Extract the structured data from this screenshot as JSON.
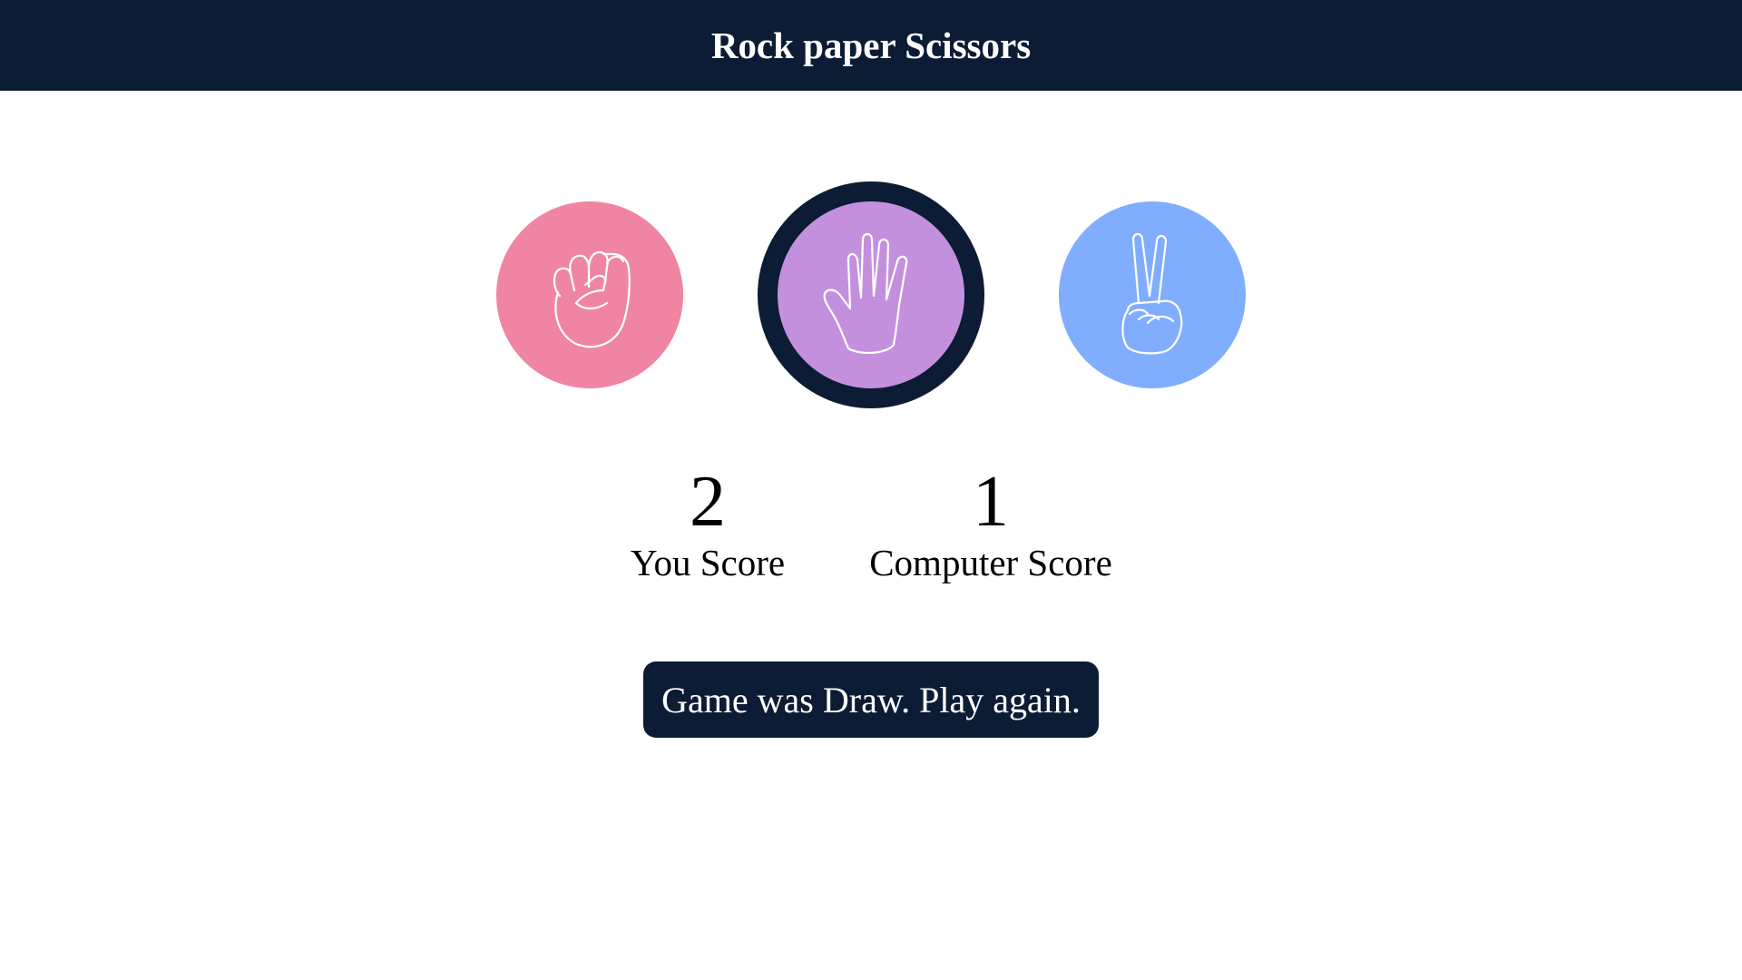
{
  "header": {
    "title": "Rock paper Scissors"
  },
  "choices": [
    {
      "name": "rock",
      "icon": "fist-icon",
      "color": "#f085a3",
      "selected": false
    },
    {
      "name": "paper",
      "icon": "open-hand-icon",
      "color": "#c490de",
      "selected": true
    },
    {
      "name": "scissors",
      "icon": "peace-sign-hand-icon",
      "color": "#80adfe",
      "selected": false
    }
  ],
  "scores": {
    "you": {
      "value": "2",
      "label": "You Score"
    },
    "computer": {
      "value": "1",
      "label": "Computer Score"
    }
  },
  "result": {
    "message": "Game was Draw. Play again."
  },
  "colors": {
    "navbar": "#0b1c34",
    "selected_border": "#0b1c34",
    "result_background": "#0b1c34"
  }
}
